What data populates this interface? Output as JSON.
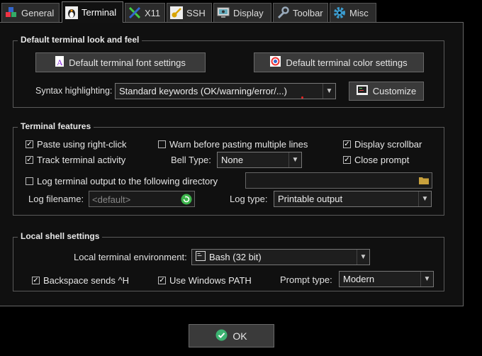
{
  "tabs": [
    {
      "label": "General",
      "icon": "cubes-icon"
    },
    {
      "label": "Terminal",
      "icon": "penguin-icon",
      "active": true
    },
    {
      "label": "X11",
      "icon": "x11-icon"
    },
    {
      "label": "SSH",
      "icon": "key-icon"
    },
    {
      "label": "Display",
      "icon": "monitor-icon"
    },
    {
      "label": "Toolbar",
      "icon": "wrench-icon"
    },
    {
      "label": "Misc",
      "icon": "gear-icon"
    }
  ],
  "look_feel": {
    "title": "Default terminal look and feel",
    "font_button": "Default terminal font settings",
    "color_button": "Default terminal color settings",
    "syntax_label": "Syntax highlighting:",
    "syntax_value": "Standard keywords (OK/warning/error/...)",
    "customize_button": "Customize"
  },
  "features": {
    "title": "Terminal features",
    "paste_right_click": "Paste using right-click",
    "warn_paste": "Warn before pasting multiple lines",
    "display_scrollbar": "Display scrollbar",
    "track_activity": "Track terminal activity",
    "bell_label": "Bell Type:",
    "bell_value": "None",
    "close_prompt": "Close prompt",
    "log_output": "Log terminal output to the following directory",
    "log_filename_label": "Log filename:",
    "log_filename_placeholder": "<default>",
    "log_type_label": "Log type:",
    "log_type_value": "Printable output"
  },
  "shell": {
    "title": "Local shell settings",
    "env_label": "Local terminal environment:",
    "env_value": "Bash (32 bit)",
    "backspace": "Backspace sends ^H",
    "windows_path": "Use Windows PATH",
    "prompt_label": "Prompt type:",
    "prompt_value": "Modern"
  },
  "ok_button": "OK",
  "colors": {
    "background": "#000000",
    "panel": "#101010",
    "button": "#3a3a3a",
    "ok_green": "#3cb371"
  }
}
